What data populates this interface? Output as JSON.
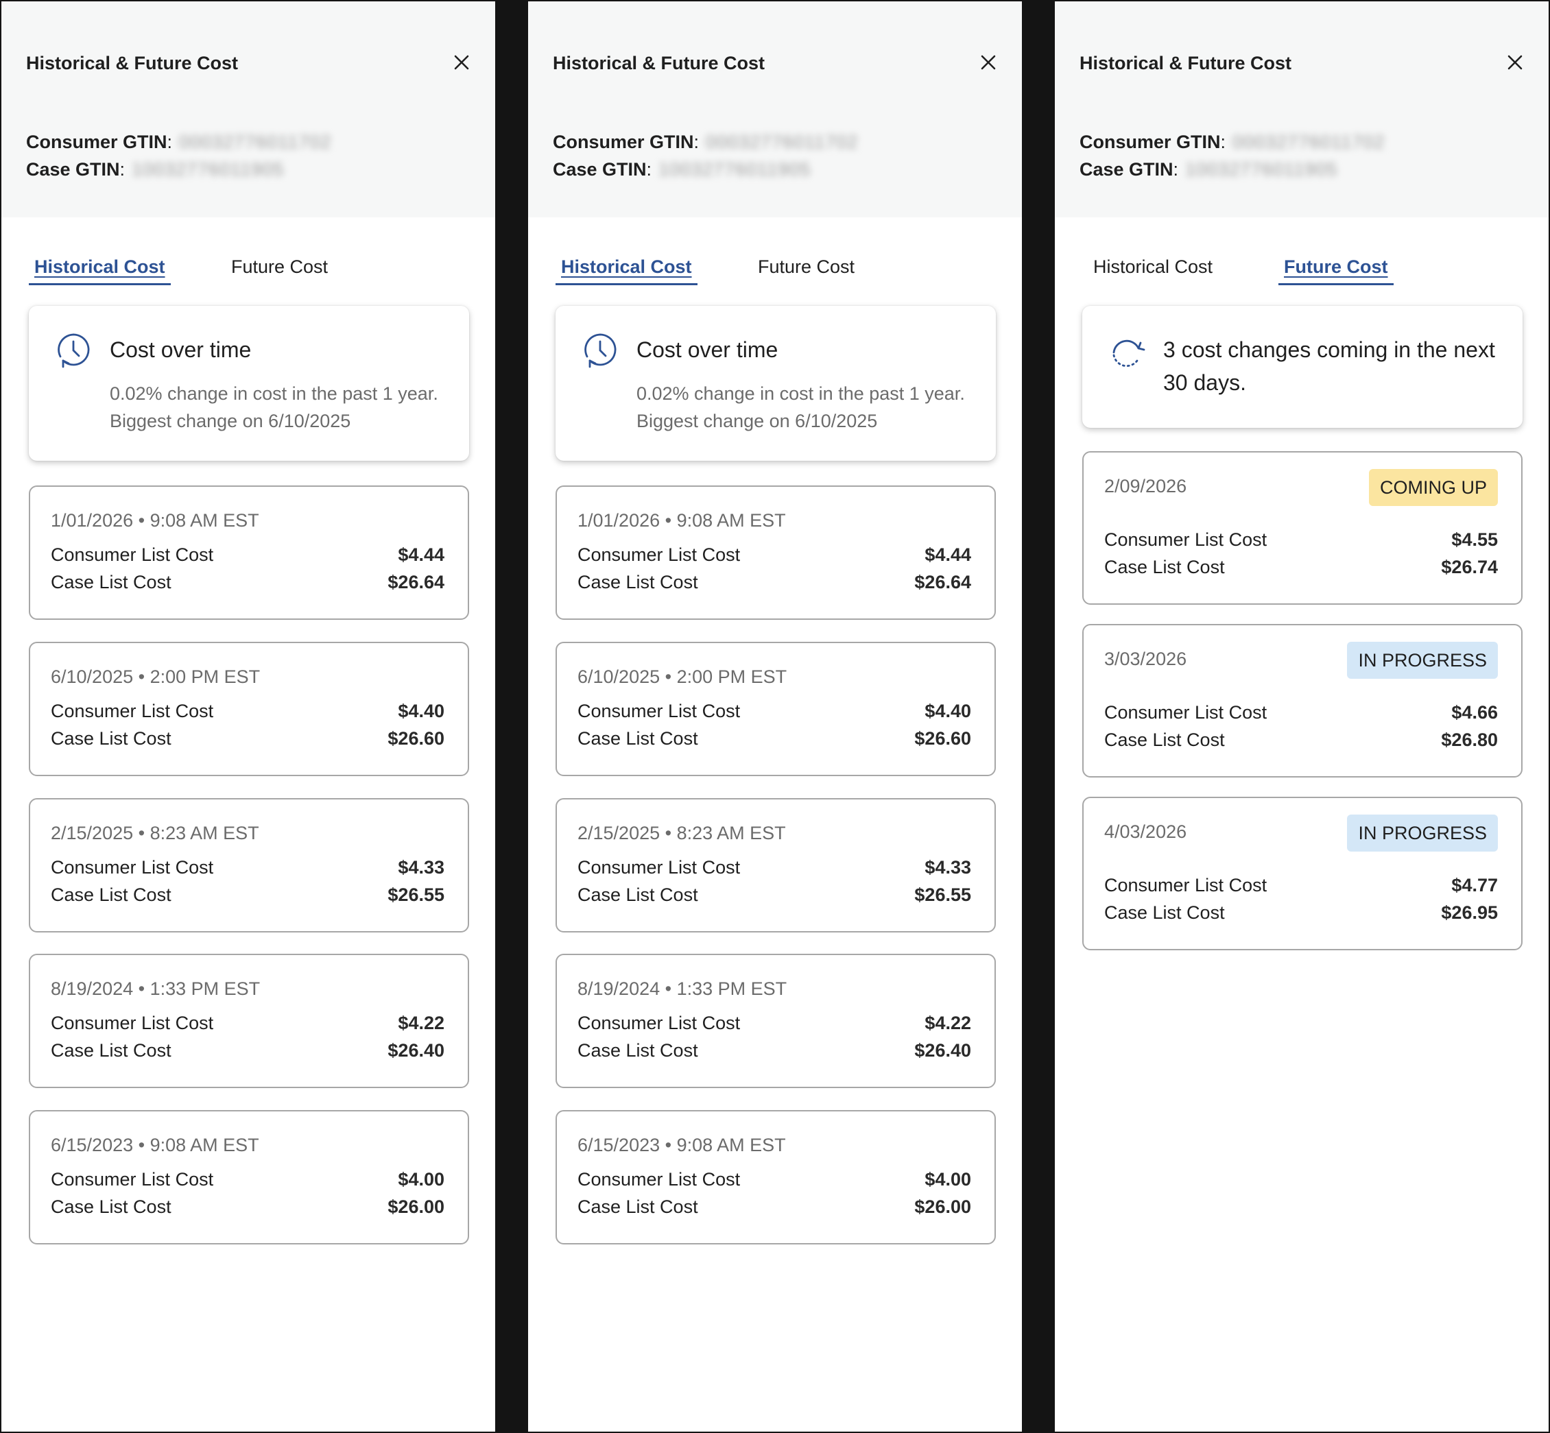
{
  "panels": [
    {
      "title": "Historical & Future Cost",
      "consumer_gtin_label": "Consumer GTIN",
      "consumer_gtin_value": "00032776011702",
      "case_gtin_label": "Case GTIN",
      "case_gtin_value": "10032776011905",
      "tabs": [
        {
          "label": "Historical Cost",
          "active": true
        },
        {
          "label": "Future Cost",
          "active": false
        }
      ],
      "summary": {
        "title": "Cost over time",
        "line1": "0.02% change in cost in the past 1 year.",
        "line2": "Biggest change on 6/10/2025"
      },
      "entries": [
        {
          "date": "1/01/2026 • 9:08 AM EST",
          "consumer_label": "Consumer List Cost",
          "consumer_cost": "$4.44",
          "case_label": "Case List Cost",
          "case_cost": "$26.64"
        },
        {
          "date": "6/10/2025 • 2:00 PM EST",
          "consumer_label": "Consumer List Cost",
          "consumer_cost": "$4.40",
          "case_label": "Case List Cost",
          "case_cost": "$26.60"
        },
        {
          "date": "2/15/2025 • 8:23 AM EST",
          "consumer_label": "Consumer List Cost",
          "consumer_cost": "$4.33",
          "case_label": "Case List Cost",
          "case_cost": "$26.55"
        },
        {
          "date": "8/19/2024 • 1:33 PM EST",
          "consumer_label": "Consumer List Cost",
          "consumer_cost": "$4.22",
          "case_label": "Case List Cost",
          "case_cost": "$26.40"
        },
        {
          "date": "6/15/2023 • 9:08 AM EST",
          "consumer_label": "Consumer List Cost",
          "consumer_cost": "$4.00",
          "case_label": "Case List Cost",
          "case_cost": "$26.00"
        }
      ]
    },
    {
      "title": "Historical & Future Cost",
      "consumer_gtin_label": "Consumer GTIN",
      "consumer_gtin_value": "00032776011702",
      "case_gtin_label": "Case GTIN",
      "case_gtin_value": "10032776011905",
      "tabs": [
        {
          "label": "Historical Cost",
          "active": true
        },
        {
          "label": "Future Cost",
          "active": false
        }
      ],
      "summary": {
        "title": "Cost over time",
        "line1": "0.02% change in cost in the past 1 year.",
        "line2": "Biggest change on 6/10/2025"
      },
      "entries": [
        {
          "date": "1/01/2026 • 9:08 AM EST",
          "consumer_label": "Consumer List Cost",
          "consumer_cost": "$4.44",
          "case_label": "Case List Cost",
          "case_cost": "$26.64"
        },
        {
          "date": "6/10/2025 • 2:00 PM EST",
          "consumer_label": "Consumer List Cost",
          "consumer_cost": "$4.40",
          "case_label": "Case List Cost",
          "case_cost": "$26.60"
        },
        {
          "date": "2/15/2025 • 8:23 AM EST",
          "consumer_label": "Consumer List Cost",
          "consumer_cost": "$4.33",
          "case_label": "Case List Cost",
          "case_cost": "$26.55"
        },
        {
          "date": "8/19/2024 • 1:33 PM EST",
          "consumer_label": "Consumer List Cost",
          "consumer_cost": "$4.22",
          "case_label": "Case List Cost",
          "case_cost": "$26.40"
        },
        {
          "date": "6/15/2023 • 9:08 AM EST",
          "consumer_label": "Consumer List Cost",
          "consumer_cost": "$4.00",
          "case_label": "Case List Cost",
          "case_cost": "$26.00"
        }
      ]
    },
    {
      "title": "Historical & Future Cost",
      "consumer_gtin_label": "Consumer GTIN",
      "consumer_gtin_value": "00032776011702",
      "case_gtin_label": "Case GTIN",
      "case_gtin_value": "10032776011905",
      "tabs": [
        {
          "label": "Historical Cost",
          "active": false
        },
        {
          "label": "Future Cost",
          "active": true
        }
      ],
      "summary": {
        "text": "3 cost changes coming in the next 30 days."
      },
      "entries": [
        {
          "date": "2/09/2026",
          "status": "COMING UP",
          "consumer_label": "Consumer List Cost",
          "consumer_cost": "$4.55",
          "case_label": "Case List Cost",
          "case_cost": "$26.74"
        },
        {
          "date": "3/03/2026",
          "status": "IN PROGRESS",
          "consumer_label": "Consumer List Cost",
          "consumer_cost": "$4.66",
          "case_label": "Case List Cost",
          "case_cost": "$26.80"
        },
        {
          "date": "4/03/2026",
          "status": "IN PROGRESS",
          "consumer_label": "Consumer List Cost",
          "consumer_cost": "$4.77",
          "case_label": "Case List Cost",
          "case_cost": "$26.95"
        }
      ]
    }
  ],
  "colors": {
    "accent": "#2d5294",
    "coming_up_badge": "#fbe5a0",
    "in_progress_badge": "#d4e7f7",
    "header_bg": "#f6f7f7",
    "divider_bg": "#141414"
  },
  "icons": {
    "close": "close-icon",
    "history": "clock-history-icon",
    "future": "refresh-arrow-icon"
  }
}
